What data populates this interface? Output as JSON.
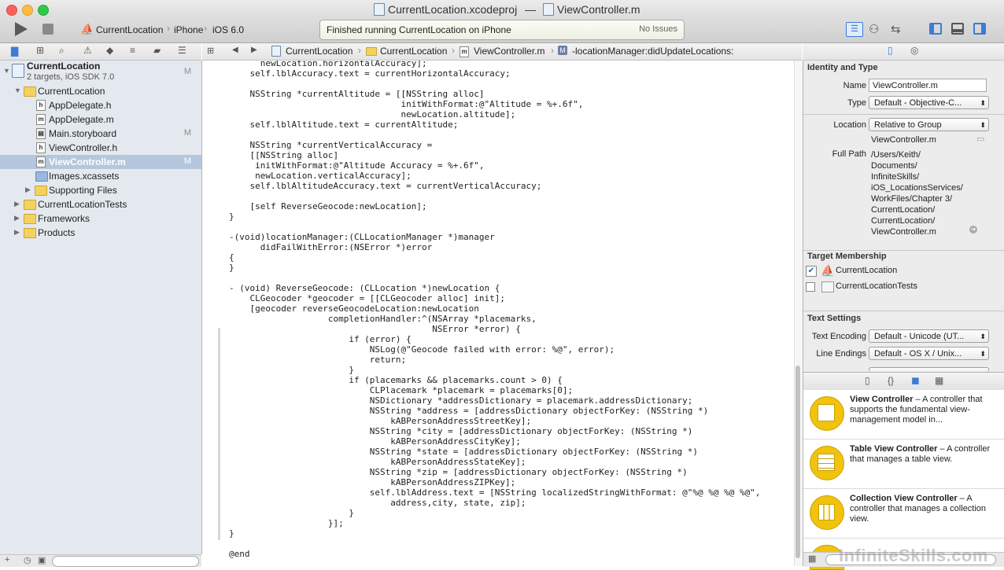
{
  "window": {
    "title_project": "CurrentLocation.xcodeproj",
    "title_sep": "—",
    "title_file": "ViewController.m"
  },
  "toolbar": {
    "scheme": "CurrentLocation",
    "device": "iPhone",
    "sdk": "iOS 6.0",
    "status": "Finished running CurrentLocation on iPhone",
    "issues": "No Issues"
  },
  "jumpbar": {
    "crumbs": [
      "CurrentLocation",
      "CurrentLocation",
      "ViewController.m",
      "-locationManager:didUpdateLocations:"
    ]
  },
  "navigator": {
    "project": {
      "name": "CurrentLocation",
      "subtitle": "2 targets, iOS SDK 7.0",
      "badge": "M"
    },
    "items": [
      {
        "label": "CurrentLocation",
        "type": "folder",
        "level": 1,
        "expanded": true,
        "badge": ""
      },
      {
        "label": "AppDelegate.h",
        "type": "h",
        "level": 2,
        "badge": ""
      },
      {
        "label": "AppDelegate.m",
        "type": "m",
        "level": 2,
        "badge": ""
      },
      {
        "label": "Main.storyboard",
        "type": "sb",
        "level": 2,
        "badge": "M"
      },
      {
        "label": "ViewController.h",
        "type": "h",
        "level": 2,
        "badge": ""
      },
      {
        "label": "ViewController.m",
        "type": "m",
        "level": 2,
        "badge": "M",
        "selected": true
      },
      {
        "label": "Images.xcassets",
        "type": "assets",
        "level": 2,
        "badge": ""
      },
      {
        "label": "Supporting Files",
        "type": "folder",
        "level": 2,
        "badge": ""
      },
      {
        "label": "CurrentLocationTests",
        "type": "folder",
        "level": 1,
        "badge": ""
      },
      {
        "label": "Frameworks",
        "type": "folder",
        "level": 1,
        "badge": ""
      },
      {
        "label": "Products",
        "type": "folder",
        "level": 1,
        "badge": ""
      }
    ]
  },
  "code_lines": [
    "      newLocation.horizontalAccuracy];",
    "    self.lblAccuracy.text = currentHorizontalAccuracy;",
    "",
    "    NSString *currentAltitude = [[NSString alloc]",
    "                                 initWithFormat:@\"Altitude = %+.6f\",",
    "                                 newLocation.altitude];",
    "    self.lblAltitude.text = currentAltitude;",
    "",
    "    NSString *currentVerticalAccuracy =",
    "    [[NSString alloc]",
    "     initWithFormat:@\"Altitude Accuracy = %+.6f\",",
    "     newLocation.verticalAccuracy];",
    "    self.lblAltitudeAccuracy.text = currentVerticalAccuracy;",
    "",
    "    [self ReverseGeocode:newLocation];",
    "}",
    "",
    "-(void)locationManager:(CLLocationManager *)manager",
    "      didFailWithError:(NSError *)error",
    "{",
    "}",
    "",
    "- (void) ReverseGeocode: (CLLocation *)newLocation {",
    "    CLGeocoder *geocoder = [[CLGeocoder alloc] init];",
    "    [geocoder reverseGeocodeLocation:newLocation",
    "                   completionHandler:^(NSArray *placemarks,",
    "                                       NSError *error) {",
    "                       if (error) {",
    "                           NSLog(@\"Geocode failed with error: %@\", error);",
    "                           return;",
    "                       }",
    "                       if (placemarks && placemarks.count > 0) {",
    "                           CLPlacemark *placemark = placemarks[0];",
    "                           NSDictionary *addressDictionary = placemark.addressDictionary;",
    "                           NSString *address = [addressDictionary objectForKey: (NSString *)",
    "                               kABPersonAddressStreetKey];",
    "                           NSString *city = [addressDictionary objectForKey: (NSString *)",
    "                               kABPersonAddressCityKey];",
    "                           NSString *state = [addressDictionary objectForKey: (NSString *)",
    "                               kABPersonAddressStateKey];",
    "                           NSString *zip = [addressDictionary objectForKey: (NSString *)",
    "                               kABPersonAddressZIPKey];",
    "                           self.lblAddress.text = [NSString localizedStringWithFormat: @\"%@ %@ %@ %@\",",
    "                               address,city, state, zip];",
    "                       }",
    "                   }];",
    "}",
    "",
    "@end"
  ],
  "inspector": {
    "identity_header": "Identity and Type",
    "name_label": "Name",
    "name_value": "ViewController.m",
    "type_label": "Type",
    "type_value": "Default - Objective-C...",
    "location_label": "Location",
    "location_value": "Relative to Group",
    "location_file": "ViewController.m",
    "fullpath_label": "Full Path",
    "fullpath_lines": [
      "/Users/Keith/",
      "Documents/",
      "InfiniteSkills/",
      "iOS_LocationsServices/",
      "WorkFiles/Chapter 3/",
      "CurrentLocation/",
      "CurrentLocation/",
      "ViewController.m"
    ],
    "target_header": "Target Membership",
    "targets": [
      {
        "name": "CurrentLocation",
        "checked": true
      },
      {
        "name": "CurrentLocationTests",
        "checked": false
      }
    ],
    "text_header": "Text Settings",
    "encoding_label": "Text Encoding",
    "encoding_value": "Default - Unicode (UT...",
    "endings_label": "Line Endings",
    "endings_value": "Default - OS X / Unix..."
  },
  "library": [
    {
      "title": "View Controller",
      "desc": " – A controller that supports the fundamental view-management model in..."
    },
    {
      "title": "Table View Controller",
      "desc": " – A controller that manages a table view."
    },
    {
      "title": "Collection View Controller",
      "desc": " – A controller that manages a collection view."
    }
  ],
  "watermark": "InfiniteSkills.com",
  "colors": {
    "accent": "#3d7bd6",
    "selection": "#b5c7de",
    "keyword": "#a5239d",
    "string": "#c31a16"
  }
}
